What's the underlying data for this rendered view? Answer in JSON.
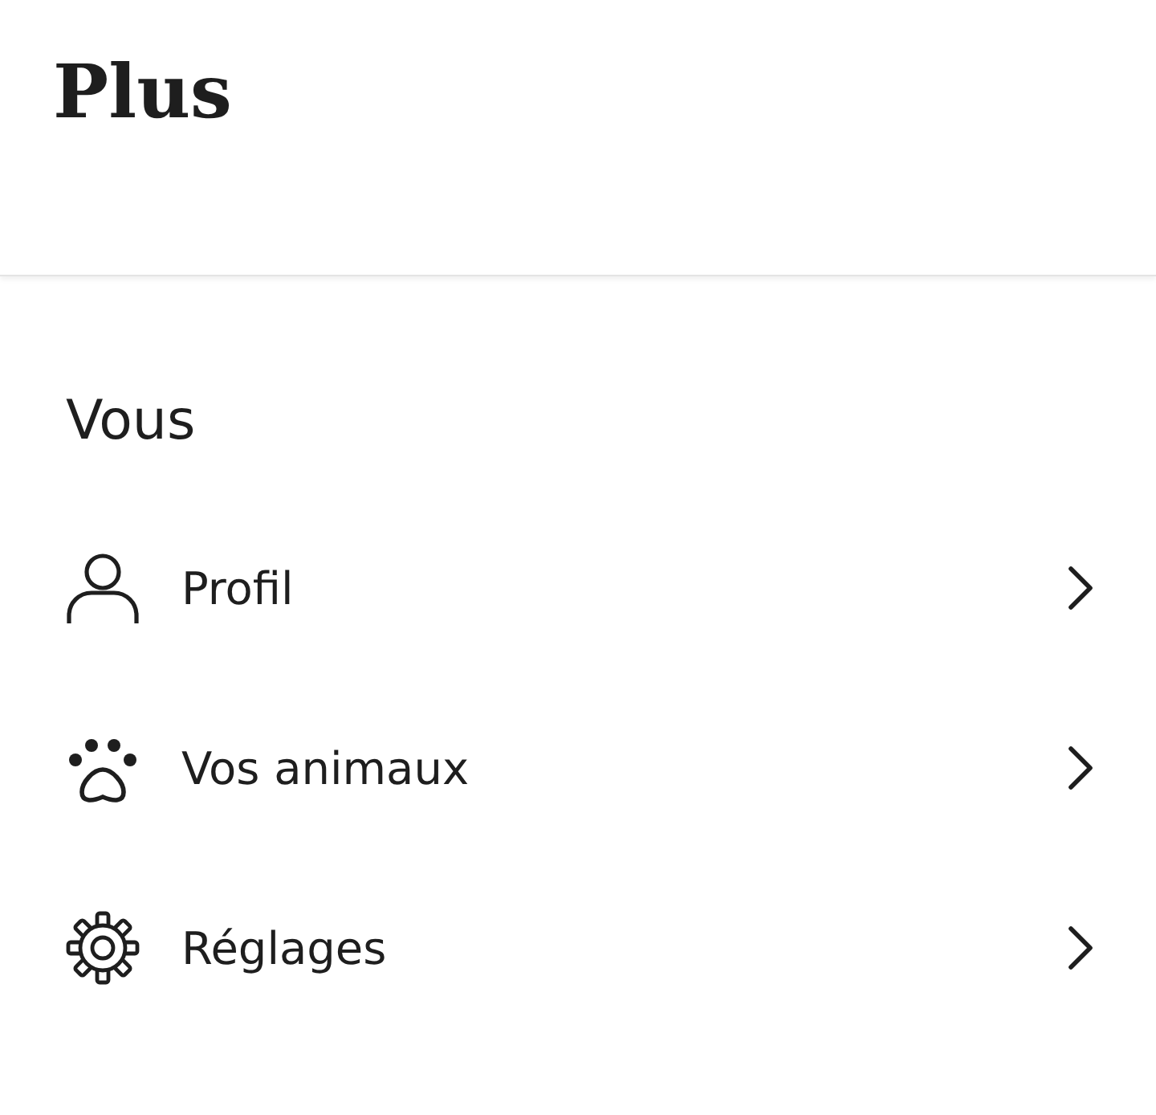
{
  "header": {
    "title": "Plus"
  },
  "section": {
    "title": "Vous",
    "items": [
      {
        "kind": "profile",
        "label": "Profil"
      },
      {
        "kind": "pets",
        "label": "Vos animaux"
      },
      {
        "kind": "settings",
        "label": "Réglages"
      }
    ]
  }
}
